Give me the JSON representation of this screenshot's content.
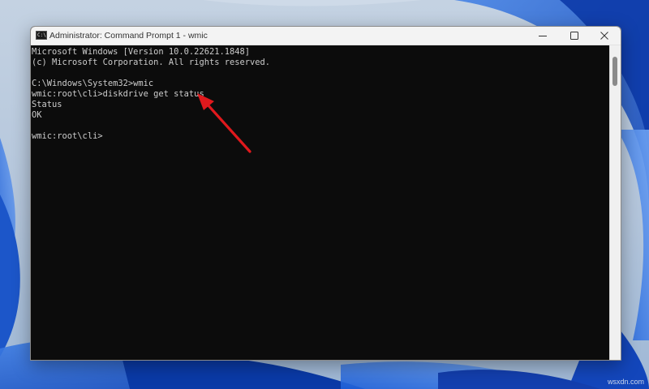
{
  "window": {
    "title": "Administrator: Command Prompt 1 - wmic",
    "icon_name": "command-prompt-icon",
    "icon_glyph": "C:\\",
    "controls": {
      "minimize_icon": "minimize-icon",
      "maximize_icon": "maximize-icon",
      "close_icon": "close-icon"
    }
  },
  "console": {
    "lines": [
      "Microsoft Windows [Version 10.0.22621.1848]",
      "(c) Microsoft Corporation. All rights reserved.",
      "",
      "C:\\Windows\\System32>wmic",
      "wmic:root\\cli>diskdrive get status",
      "Status",
      "OK",
      "",
      "wmic:root\\cli>"
    ],
    "text_color": "#cccccc",
    "background_color": "#0c0c0c"
  },
  "annotation": {
    "type": "arrow",
    "color": "#e0191d"
  },
  "watermark": "wsxdn.com",
  "colors": {
    "wallpaper": "#b9c9dc",
    "wallpaper_accent": "#1e56c8"
  }
}
